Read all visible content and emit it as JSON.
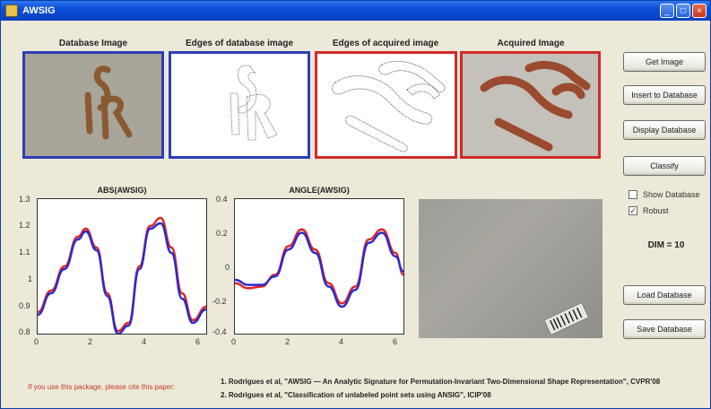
{
  "window": {
    "title": "AWSIG"
  },
  "images": {
    "database_label": "Database Image",
    "db_edges_label": "Edges of database image",
    "acq_edges_label": "Edges of acquired image",
    "acquired_label": "Acquired Image"
  },
  "plots": {
    "abs": {
      "title": "ABS(AWSIG)",
      "yticks": [
        "1.3",
        "1.2",
        "1.1",
        "1",
        "0.9",
        "0.8"
      ],
      "xticks": [
        "0",
        "2",
        "4",
        "6"
      ]
    },
    "angle": {
      "title": "ANGLE(AWSIG)",
      "yticks": [
        "0.4",
        "0.2",
        "0",
        "-0.2",
        "-0.4"
      ],
      "xticks": [
        "0",
        "2",
        "4",
        "6"
      ]
    }
  },
  "chart_data": [
    {
      "type": "line",
      "title": "ABS(AWSIG)",
      "xlim": [
        0,
        6.3
      ],
      "ylim": [
        0.8,
        1.3
      ],
      "x": [
        0,
        0.5,
        1,
        1.5,
        1.8,
        2.2,
        2.6,
        3.0,
        3.4,
        3.8,
        4.2,
        4.6,
        5.0,
        5.4,
        5.8,
        6.3
      ],
      "series": [
        {
          "color": "#e02424",
          "values": [
            0.88,
            0.96,
            1.05,
            1.16,
            1.19,
            1.12,
            0.95,
            0.81,
            0.84,
            1.05,
            1.2,
            1.23,
            1.12,
            0.95,
            0.85,
            0.9
          ]
        },
        {
          "color": "#2a2ad0",
          "values": [
            0.87,
            0.95,
            1.04,
            1.15,
            1.18,
            1.11,
            0.94,
            0.8,
            0.83,
            1.04,
            1.19,
            1.21,
            1.1,
            0.93,
            0.84,
            0.89
          ]
        }
      ]
    },
    {
      "type": "line",
      "title": "ANGLE(AWSIG)",
      "xlim": [
        0,
        6.3
      ],
      "ylim": [
        -0.4,
        0.4
      ],
      "x": [
        0,
        0.5,
        1,
        1.5,
        2,
        2.5,
        3,
        3.5,
        4,
        4.5,
        5,
        5.5,
        6,
        6.3
      ],
      "series": [
        {
          "color": "#e02424",
          "values": [
            -0.1,
            -0.13,
            -0.12,
            -0.05,
            0.12,
            0.22,
            0.1,
            -0.1,
            -0.22,
            -0.12,
            0.16,
            0.22,
            0.08,
            -0.05
          ]
        },
        {
          "color": "#2a2ad0",
          "values": [
            -0.08,
            -0.11,
            -0.11,
            -0.06,
            0.1,
            0.2,
            0.08,
            -0.12,
            -0.24,
            -0.14,
            0.14,
            0.2,
            0.06,
            -0.03
          ]
        }
      ]
    }
  ],
  "buttons": {
    "get_image": "Get Image",
    "insert_db": "Insert to Database",
    "display_db": "Display Database",
    "classify": "Classify",
    "load_db": "Load Database",
    "save_db": "Save Database"
  },
  "checkboxes": {
    "show_db": "Show Database",
    "robust": "Robust",
    "robust_checked": "✓"
  },
  "dim": "DIM = 10",
  "footer": {
    "note": "If you use this package, please cite this paper:",
    "ref1": "1. Rodrigues et al, \"AWSIG — An Analytic Signature for Permutation-Invariant Two-Dimensional Shape Representation\", CVPR'08",
    "ref2": "2. Rodrigues et al, \"Classification of unlabeled point sets using ANSIG\", ICIP'08"
  }
}
